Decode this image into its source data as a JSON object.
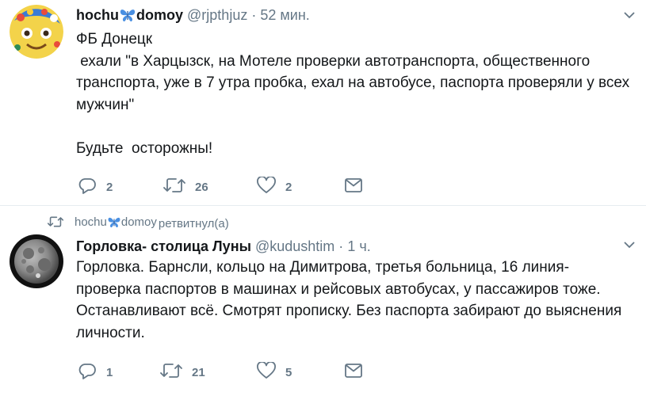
{
  "tweet1": {
    "name_part1": "hochu",
    "name_part2": "domoy",
    "handle": "@rjpthjuz",
    "separator": "·",
    "time": "52 мин.",
    "lines": [
      "ФБ Донецк",
      " ехали \"в Харцызск, на Мотеле проверки автотранспорта, общественного транспорта, уже в 7 утра пробка, ехал на автобусе, паспорта проверяли у всех мужчин\"",
      "Будьте  осторожны!"
    ],
    "reply_count": "2",
    "retweet_count": "26",
    "like_count": "2"
  },
  "retweet_context": {
    "user_part1": "hochu",
    "user_part2": "domoy",
    "action": "ретвитнул(а)"
  },
  "tweet2": {
    "name": "Горловка- столица Луны",
    "handle": "@kudushtim",
    "separator": "·",
    "time": "1 ч.",
    "text": "Горловка. Барнсли, кольцо на Димитрова, третья больница, 16 линия- проверка паспортов в машинах и рейсовых автобусах, у пассажиров тоже. Останавливают всё. Смотрят прописку. Без паспорта забирают до выяснения личности.",
    "reply_count": "1",
    "retweet_count": "21",
    "like_count": "5"
  },
  "icons": {
    "reply": "reply-icon",
    "retweet": "retweet-icon",
    "like": "heart-icon",
    "dm": "direct-message-icon",
    "caret": "chevron-down-icon",
    "butterfly": "butterfly-emoji-icon"
  },
  "colors": {
    "text": "#14171a",
    "secondary": "#657786",
    "butterfly": "#4a90e2",
    "divider": "#e6ecf0"
  }
}
